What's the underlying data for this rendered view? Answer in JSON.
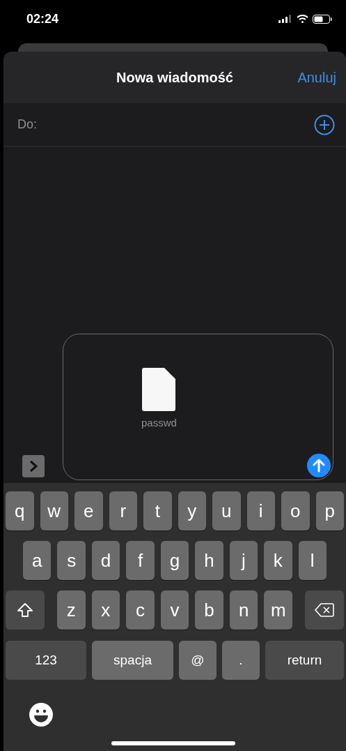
{
  "status_bar": {
    "time": "02:24"
  },
  "header": {
    "title": "Nowa wiadomość",
    "cancel": "Anuluj"
  },
  "to_field": {
    "label": "Do:"
  },
  "attachment": {
    "file_name": "passwd"
  },
  "keyboard": {
    "rows": [
      [
        "q",
        "w",
        "e",
        "r",
        "t",
        "y",
        "u",
        "i",
        "o",
        "p"
      ],
      [
        "a",
        "s",
        "d",
        "f",
        "g",
        "h",
        "j",
        "k",
        "l"
      ],
      [
        "z",
        "x",
        "c",
        "v",
        "b",
        "n",
        "m"
      ]
    ],
    "bottom_row": [
      {
        "label": "123",
        "kind": "mode"
      },
      {
        "label": "spacja",
        "kind": "space"
      },
      {
        "label": "@",
        "kind": "char"
      },
      {
        "label": ".",
        "kind": "char"
      },
      {
        "label": "return",
        "kind": "return"
      }
    ]
  }
}
